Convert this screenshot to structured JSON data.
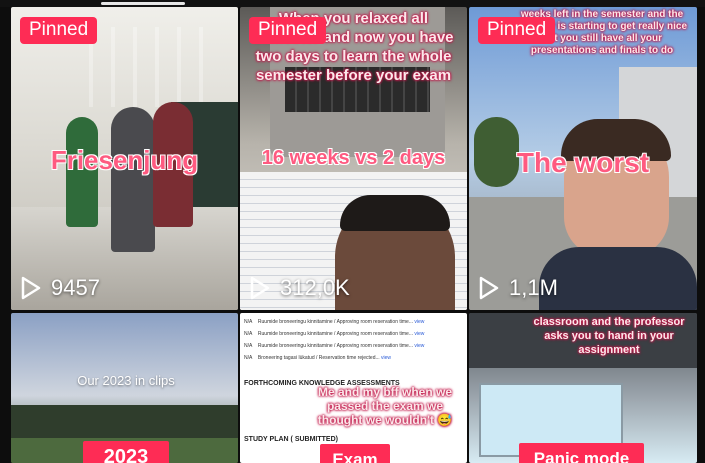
{
  "tiles": [
    {
      "pinned": "Pinned",
      "caption": "Friesenjung",
      "views": "9457"
    },
    {
      "pinned": "Pinned",
      "overlay": "When you relaxed all semester and now you have two days to learn the whole semester before your exam",
      "caption": "16 weeks vs 2 days",
      "views": "312,0K"
    },
    {
      "pinned": "Pinned",
      "overlay": "weeks left in the semester and the weather is starting to get really nice but you still have all your presentations and finals to do",
      "caption": "The worst",
      "views": "1,1M"
    },
    {
      "overlay": "Our 2023 in clips",
      "label": "2023"
    },
    {
      "doc_rows": [
        {
          "col": "N/A",
          "text": "Ruumide broneeringu kinnitamine / Approving room reservation time...",
          "link": "view"
        },
        {
          "col": "N/A",
          "text": "Ruumide broneeringu kinnitamine / Approving room reservation time...",
          "link": "view"
        },
        {
          "col": "N/A",
          "text": "Ruumide broneeringu kinnitamine / Approving room reservation time...",
          "link": "view"
        },
        {
          "col": "N/A",
          "text": "Broneering tagasi lükatud / Reservation time rejected...",
          "link": "view"
        }
      ],
      "section1": "FORTHCOMING KNOWLEDGE ASSESSMENTS",
      "section2": "STUDY PLAN ( SUBMITTED)",
      "overlay": "Me and my bff when we passed the exam we thought we wouldn't 😅",
      "label": "Exam"
    },
    {
      "overlay": "classroom and the professor asks you to hand in your assignment",
      "label": "Panic mode"
    }
  ],
  "colors": {
    "accent": "#fe2c55",
    "caption": "#fe5a80",
    "background": "#0d0d0d"
  },
  "icons": {
    "play": "play-icon"
  }
}
